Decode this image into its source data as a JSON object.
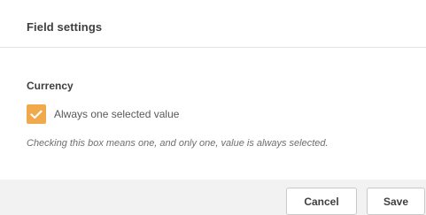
{
  "dialog": {
    "title": "Field settings"
  },
  "section": {
    "label": "Currency",
    "checkbox": {
      "label": "Always one selected value",
      "checked": true,
      "check_color": "#f0a94b",
      "icon": "checkmark-icon"
    },
    "help_text": "Checking this box means one, and only one, value is always selected."
  },
  "footer": {
    "cancel_label": "Cancel",
    "save_label": "Save"
  }
}
